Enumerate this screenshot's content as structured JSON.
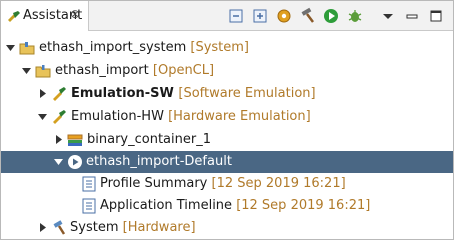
{
  "tab": {
    "label": "Assistant",
    "close_glyph": "⊗",
    "icon": "assistant-icon"
  },
  "toolbar": {
    "buttons": [
      {
        "name": "collapse-all-icon"
      },
      {
        "name": "expand-all-icon"
      },
      {
        "name": "settings-gear-icon"
      },
      {
        "name": "build-hammer-icon"
      },
      {
        "name": "run-icon"
      },
      {
        "name": "debug-bug-icon"
      },
      {
        "name": "view-menu-icon"
      },
      {
        "name": "minimize-icon"
      },
      {
        "name": "maximize-icon"
      }
    ]
  },
  "tree": {
    "items": [
      {
        "label": "ethash_import_system",
        "decoration": "[System]"
      },
      {
        "label": "ethash_import",
        "decoration": "[OpenCL]"
      },
      {
        "label": "Emulation-SW",
        "decoration": "[Software Emulation]"
      },
      {
        "label": "Emulation-HW",
        "decoration": "[Hardware Emulation]"
      },
      {
        "label": "binary_container_1",
        "decoration": ""
      },
      {
        "label": "ethash_import-Default",
        "decoration": ""
      },
      {
        "label": "Profile Summary",
        "decoration": "[12 Sep 2019 16:21]"
      },
      {
        "label": "Application Timeline",
        "decoration": "[12 Sep 2019 16:21]"
      },
      {
        "label": "System",
        "decoration": "[Hardware]"
      }
    ]
  },
  "colors": {
    "selection": "#4a6784",
    "decoration": "#b07a2a",
    "tab_bar": "#f2f2f2"
  }
}
